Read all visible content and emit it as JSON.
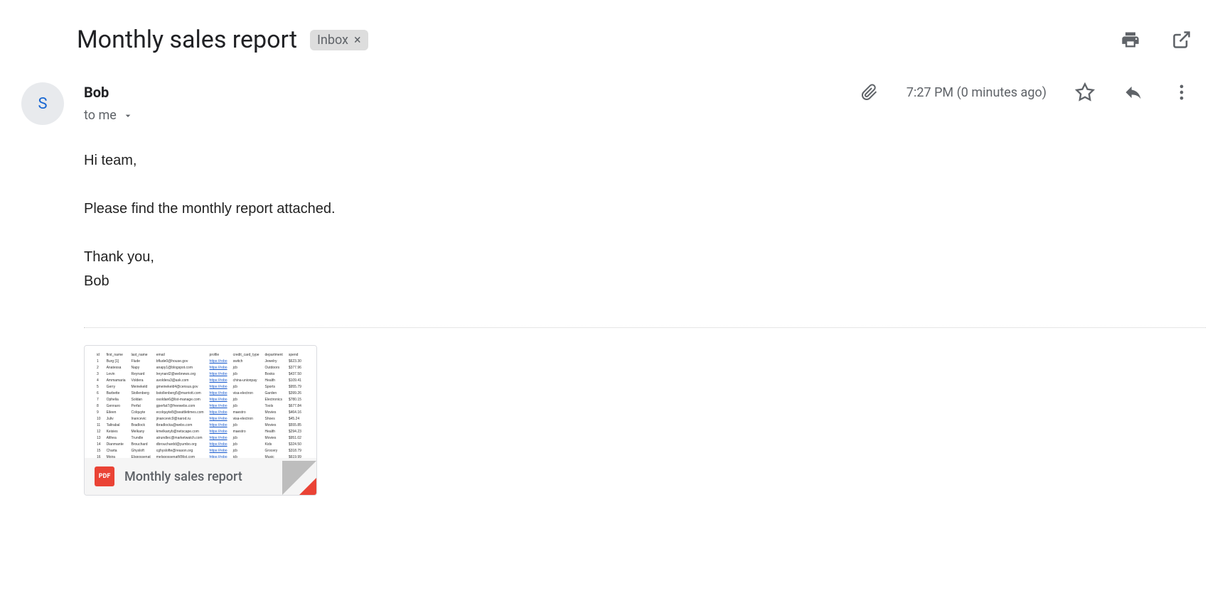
{
  "header": {
    "subject": "Monthly sales report",
    "label": "Inbox"
  },
  "sender": {
    "name": "Bob",
    "avatar_initial": "S",
    "recipient_text": "to me",
    "timestamp": "7:27 PM (0 minutes ago)"
  },
  "body": {
    "line1": "Hi team,",
    "line2": "Please find the monthly report attached.",
    "line3": "Thank you,",
    "line4": "Bob"
  },
  "attachment": {
    "badge": "PDF",
    "name": "Monthly sales report"
  },
  "icons": {
    "print": "print-icon",
    "popout": "open-new-window-icon",
    "attach": "attachment-icon",
    "star": "star-icon",
    "reply": "reply-icon",
    "more": "more-icon",
    "close": "×"
  }
}
